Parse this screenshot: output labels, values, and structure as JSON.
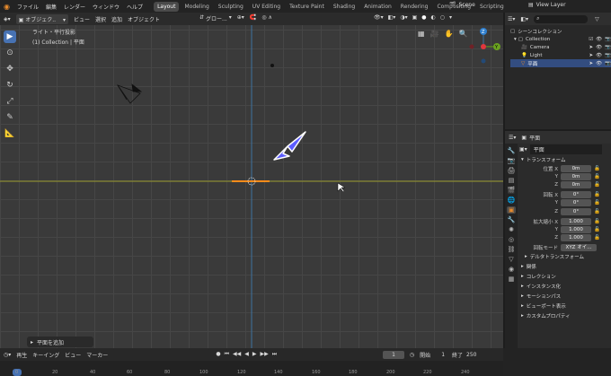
{
  "menu": {
    "items": [
      "ファイル",
      "編集",
      "レンダー",
      "ウィンドウ",
      "ヘルプ"
    ],
    "workspaces": [
      "Layout",
      "Modeling",
      "Sculpting",
      "UV Editing",
      "Texture Paint",
      "Shading",
      "Animation",
      "Rendering",
      "Compositing",
      "Scripting"
    ],
    "active_workspace": "Layout",
    "scene": "Scene",
    "view_layer": "View Layer"
  },
  "viewport_header": {
    "mode": "オブジェク..",
    "items": [
      "ビュー",
      "選択",
      "追加",
      "オブジェクト"
    ],
    "transform_orient": "グロー..."
  },
  "viewport": {
    "view_name": "ライト・平行投影",
    "context": "(1) Collection | 平面"
  },
  "gizmo": {
    "x": "X",
    "y": "Y",
    "z": "Z"
  },
  "outliner": {
    "title": "シーンコレクション",
    "collection": "Collection",
    "objects": [
      "Camera",
      "Light",
      "平面"
    ]
  },
  "properties": {
    "object_name": "平面",
    "data_name": "平面",
    "transform_title": "トランスフォーム",
    "location_label": "位置 X",
    "location": [
      "0m",
      "0m",
      "0m"
    ],
    "rotation_label": "回転 X",
    "rotation": [
      "0°",
      "0°",
      "0°"
    ],
    "scale_label": "拡大縮小 X",
    "scale": [
      "1.000",
      "1.000",
      "1.000"
    ],
    "y": "Y",
    "z": "Z",
    "rot_mode_label": "回転モード",
    "rot_mode": "XYZ オイ...",
    "delta": "デルタトランスフォーム",
    "sections": [
      "関係",
      "コレクション",
      "インスタンス化",
      "モーションパス",
      "ビューポート表示",
      "カスタムプロパティ"
    ]
  },
  "redo_panel": "平面を追加",
  "timeline": {
    "items": [
      "再生",
      "キーイング",
      "ビュー",
      "マーカー"
    ],
    "current_frame": "1",
    "start_label": "開始",
    "start": "1",
    "end_label": "終了",
    "end": "250",
    "ticks": [
      "0",
      "20",
      "40",
      "60",
      "80",
      "100",
      "120",
      "140",
      "160",
      "180",
      "200",
      "220",
      "240"
    ]
  },
  "colors": {
    "accent": "#4772b3",
    "x_axis": "#9a9a2e",
    "y_axis": "#3f73a0",
    "selection": "#ff8c1a",
    "arrow": "#6b6bff"
  }
}
